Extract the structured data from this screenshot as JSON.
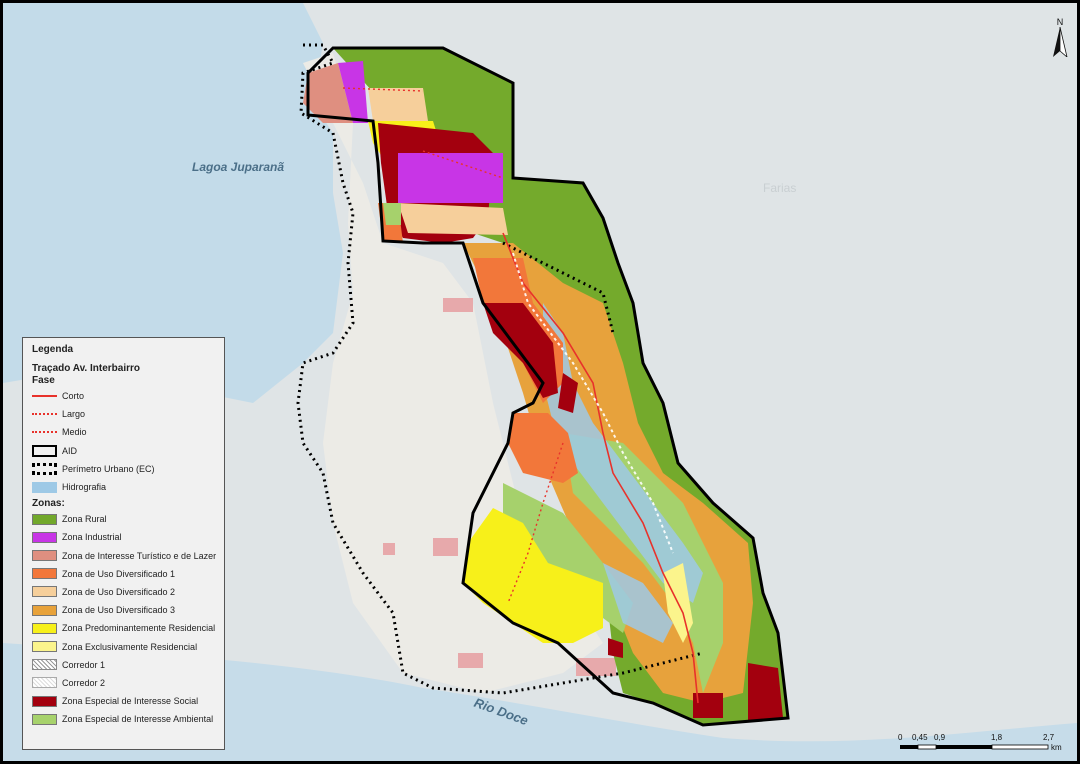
{
  "map": {
    "place_labels": {
      "lagoa": "Lagoa Juparanã",
      "rio": "Rio Doce",
      "farias": "Farias"
    }
  },
  "legend": {
    "title": "Legenda",
    "traçado_title": "Traçado Av. Interbairro",
    "fase_title": "Fase",
    "fase_items": [
      "Corto",
      "Largo",
      "Medio"
    ],
    "aid": "AID",
    "perimetro": "Perímetro Urbano (EC)",
    "hidrografia": "Hidrografia",
    "zonas_title": "Zonas:",
    "zonas": [
      {
        "label": "Zona Rural",
        "color": "#72a82b"
      },
      {
        "label": "Zona Industrial",
        "color": "#c835e6"
      },
      {
        "label": "Zona de Interesse Turístico e de Lazer",
        "color": "#df8f80"
      },
      {
        "label": "Zona de Uso Diversificado 1",
        "color": "#f2773a"
      },
      {
        "label": "Zona de Uso Diversificado 2",
        "color": "#f6cf9b"
      },
      {
        "label": "Zona de Uso Diversificado 3",
        "color": "#e8a23a"
      },
      {
        "label": "Zona Predominantemente Residencial",
        "color": "#f7f01a"
      },
      {
        "label": "Zona Exclusivamente Residencial",
        "color": "#fbf48c"
      },
      {
        "label": "Corredor 1",
        "color": "hatch1"
      },
      {
        "label": "Corredor 2",
        "color": "hatch2"
      },
      {
        "label": "Zona Especial de Interesse Social",
        "color": "#a3000e"
      },
      {
        "label": "Zona Especial de Interesse Ambiental",
        "color": "#a7d26c"
      }
    ]
  },
  "north": {
    "label": "N"
  },
  "scale": {
    "labels": [
      "0",
      "0,45",
      "0,9",
      "1,8",
      "2,7"
    ],
    "unit": "km"
  }
}
